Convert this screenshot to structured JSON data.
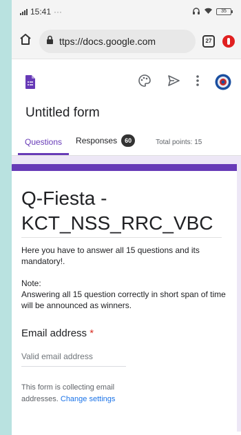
{
  "status_bar": {
    "time": "15:41",
    "dots": "···",
    "battery": "35"
  },
  "browser": {
    "url": "ttps://docs.google.com",
    "tab_count": "27"
  },
  "form": {
    "title": "Untitled form",
    "tabs": [
      {
        "label": "Questions",
        "active": true
      },
      {
        "label": "Responses",
        "badge": "60"
      }
    ],
    "total_points": "Total points: 15"
  },
  "card": {
    "title_line1": "Q-Fiesta -",
    "title_line2": "KCT_NSS_RRC_VBC",
    "description_1": "Here you have to answer all 15 questions and its mandatory!.",
    "description_2_heading": "Note:",
    "description_2_body": "Answering all 15 question correctly in short span of time will be announced as winners.",
    "email_label": "Email address",
    "required_mark": "*",
    "email_placeholder": "Valid email address",
    "collect_note": "This form is collecting email addresses.",
    "change_settings": "Change settings"
  },
  "colors": {
    "accent": "#673ab7",
    "focus_bar": "#4285f4",
    "link": "#1a73e8",
    "required": "#d93025"
  }
}
